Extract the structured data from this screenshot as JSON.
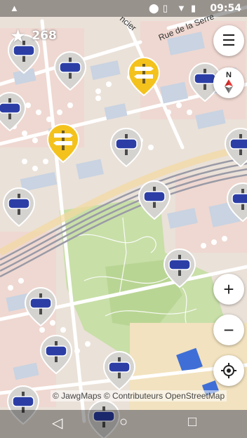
{
  "status_bar": {
    "time": "09:54",
    "icons": [
      "notification-icon",
      "location-icon",
      "vibrate-icon",
      "wifi-icon",
      "battery-icon"
    ]
  },
  "score": {
    "value": "268",
    "icon": "star-icon"
  },
  "map": {
    "street_labels": [
      "Rue de la Serre",
      "ncier"
    ],
    "attribution": "© JawgMaps  © Contributeurs OpenStreetMap"
  },
  "controls": {
    "menu": "menu-icon",
    "compass_label": "N",
    "zoom_in": "+",
    "zoom_out": "−",
    "locate": "locate-icon"
  },
  "navigation_bar": {
    "back": "◁",
    "home": "○",
    "recents": "□"
  },
  "colors": {
    "marker_blue": "#2c3ea6",
    "marker_yellow": "#f4c21d",
    "park_green": "#c8dfa8",
    "water_blue": "#3f6fd6",
    "roads": "#ffffff",
    "buildings": "#c9d3e2"
  }
}
